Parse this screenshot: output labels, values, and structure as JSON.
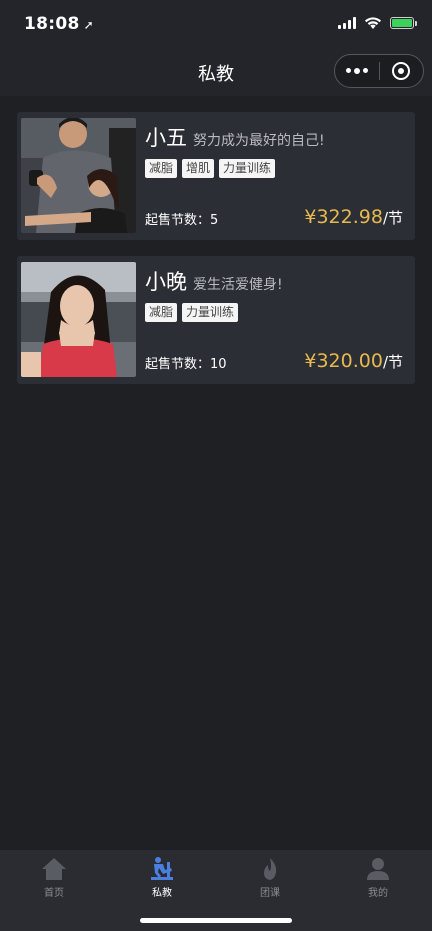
{
  "status": {
    "time": "18:08"
  },
  "nav": {
    "title": "私教"
  },
  "coaches": [
    {
      "name": "小五",
      "slogan": "努力成为最好的自己!",
      "tags": [
        "减脂",
        "增肌",
        "力量训练"
      ],
      "sessions_label": "起售节数：5",
      "price": "¥322.98",
      "unit": "/节"
    },
    {
      "name": "小晚",
      "slogan": "爱生活爱健身!",
      "tags": [
        "减脂",
        "力量训练"
      ],
      "sessions_label": "起售节数：10",
      "price": "¥320.00",
      "unit": "/节"
    }
  ],
  "tabs": [
    {
      "label": "首页",
      "icon": "home-icon"
    },
    {
      "label": "私教",
      "icon": "trainer-icon"
    },
    {
      "label": "团课",
      "icon": "flame-icon"
    },
    {
      "label": "我的",
      "icon": "user-icon"
    }
  ],
  "colors": {
    "accent": "#e7b94f",
    "active_tab": "#4a7fe0",
    "inactive_tab": "#5a5c63"
  }
}
